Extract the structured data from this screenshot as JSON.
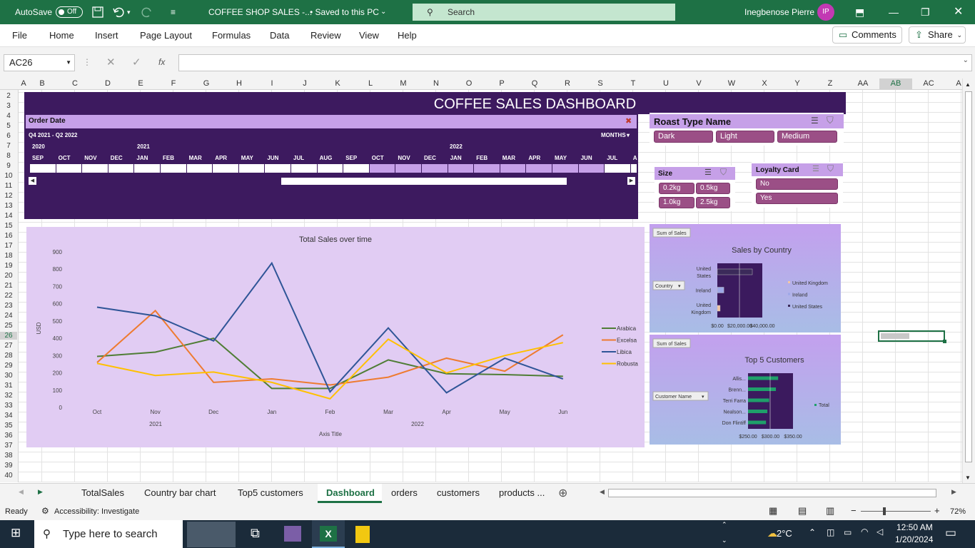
{
  "window": {
    "autosave": "AutoSave",
    "autosave_state": "Off",
    "filename": "COFFEE SHOP SALES -...",
    "saved": "• Saved to this PC",
    "search": "Search",
    "user": "Inegbenose Pierre",
    "user_initials": "IP"
  },
  "menu": {
    "items": [
      "File",
      "Home",
      "Insert",
      "Page Layout",
      "Formulas",
      "Data",
      "Review",
      "View",
      "Help"
    ],
    "comments": "Comments",
    "share": "Share"
  },
  "formula_bar": {
    "name_box": "AC26",
    "fx": "fx",
    "value": ""
  },
  "columns": [
    "A",
    "B",
    "C",
    "D",
    "E",
    "F",
    "G",
    "H",
    "I",
    "J",
    "K",
    "L",
    "M",
    "N",
    "O",
    "P",
    "Q",
    "R",
    "S",
    "T",
    "U",
    "V",
    "W",
    "X",
    "Y",
    "Z",
    "AA",
    "AB",
    "AC",
    "A"
  ],
  "rows": [
    "2",
    "3",
    "4",
    "5",
    "6",
    "7",
    "8",
    "9",
    "10",
    "11",
    "12",
    "13",
    "14",
    "15",
    "16",
    "17",
    "18",
    "19",
    "20",
    "21",
    "22",
    "23",
    "24",
    "25",
    "26",
    "27",
    "28",
    "29",
    "30",
    "31",
    "32",
    "33",
    "34",
    "35",
    "36",
    "37",
    "38",
    "39",
    "40"
  ],
  "dashboard": {
    "title": "COFFEE SALES DASHBOARD"
  },
  "timeline": {
    "header": "Order Date",
    "range": "Q4 2021 - Q2 2022",
    "level": "MONTHS",
    "years": [
      "2020",
      "2021",
      "2022"
    ],
    "months": [
      "SEP",
      "OCT",
      "NOV",
      "DEC",
      "JAN",
      "FEB",
      "MAR",
      "APR",
      "MAY",
      "JUN",
      "JUL",
      "AUG",
      "SEP",
      "OCT",
      "NOV",
      "DEC",
      "JAN",
      "FEB",
      "MAR",
      "APR",
      "MAY",
      "JUN",
      "JUL",
      "A"
    ],
    "selected_from": 13,
    "selected_to": 21
  },
  "slicers": {
    "roast": {
      "title": "Roast Type Name",
      "items": [
        "Dark",
        "Light",
        "Medium"
      ]
    },
    "size": {
      "title": "Size",
      "items": [
        "0.2kg",
        "0.5kg",
        "1.0kg",
        "2.5kg"
      ]
    },
    "loyalty": {
      "title": "Loyalty Card",
      "items": [
        "No",
        "Yes"
      ]
    }
  },
  "chart_data": [
    {
      "type": "line",
      "title": "Total Sales over time",
      "ylabel": "USD",
      "xlabel": "Axis Title",
      "ylim": [
        0,
        900
      ],
      "yticks": [
        "900",
        "800",
        "700",
        "600",
        "500",
        "400",
        "300",
        "200",
        "100",
        "0"
      ],
      "categories": [
        "Oct",
        "Nov",
        "Dec",
        "Jan",
        "Feb",
        "Mar",
        "Apr",
        "May",
        "Jun"
      ],
      "year_labels": [
        "2021",
        "2022"
      ],
      "series": [
        {
          "name": "Arabica",
          "color": "#4f7d35",
          "values": [
            295,
            320,
            400,
            110,
            110,
            275,
            195,
            190,
            180
          ]
        },
        {
          "name": "Excelsa",
          "color": "#ee7b30",
          "values": [
            260,
            560,
            145,
            165,
            130,
            175,
            285,
            210,
            420
          ]
        },
        {
          "name": "Libica",
          "color": "#2f5597",
          "values": [
            580,
            530,
            385,
            835,
            90,
            460,
            85,
            285,
            165
          ]
        },
        {
          "name": "Robusta",
          "color": "#ffc000",
          "values": [
            255,
            185,
            205,
            145,
            50,
            395,
            200,
            300,
            375
          ]
        }
      ]
    },
    {
      "type": "bar",
      "title": "Sales by Country",
      "field_button": "Sum of Sales",
      "filter_button": "Country",
      "categories": [
        "United States",
        "Ireland",
        "United Kingdom"
      ],
      "values": [
        35000,
        6500,
        2800
      ],
      "xticks": [
        "$0.00",
        "$20,000.00",
        "$40,000.00"
      ],
      "legend": [
        "United Kingdom",
        "Ireland",
        "United States"
      ],
      "colors": [
        "#f4c7a5",
        "#9da8e8",
        "#3b2a5a"
      ]
    },
    {
      "type": "bar",
      "title": "Top 5 Customers",
      "field_button": "Sum of Sales",
      "filter_button": "Customer Name",
      "categories": [
        "Allis...",
        "Brenn...",
        "Terri Farra",
        "Nealson...",
        "Don Flintiff"
      ],
      "values": [
        317,
        312,
        297,
        293,
        290
      ],
      "xticks": [
        "$250.00",
        "$300.00",
        "$350.00"
      ],
      "legend": [
        "Total"
      ],
      "colors": [
        "#1fa06a"
      ]
    }
  ],
  "sheets": {
    "tabs": [
      "TotalSales",
      "Country bar chart",
      "Top5 customers",
      "Dashboard",
      "orders",
      "customers",
      "products ..."
    ],
    "active": "Dashboard"
  },
  "status": {
    "ready": "Ready",
    "accessibility": "Accessibility: Investigate",
    "zoom": "72%"
  },
  "taskbar": {
    "search": "Type here to search",
    "temp": "2°C",
    "time": "12:50 AM",
    "date": "1/20/2024"
  }
}
